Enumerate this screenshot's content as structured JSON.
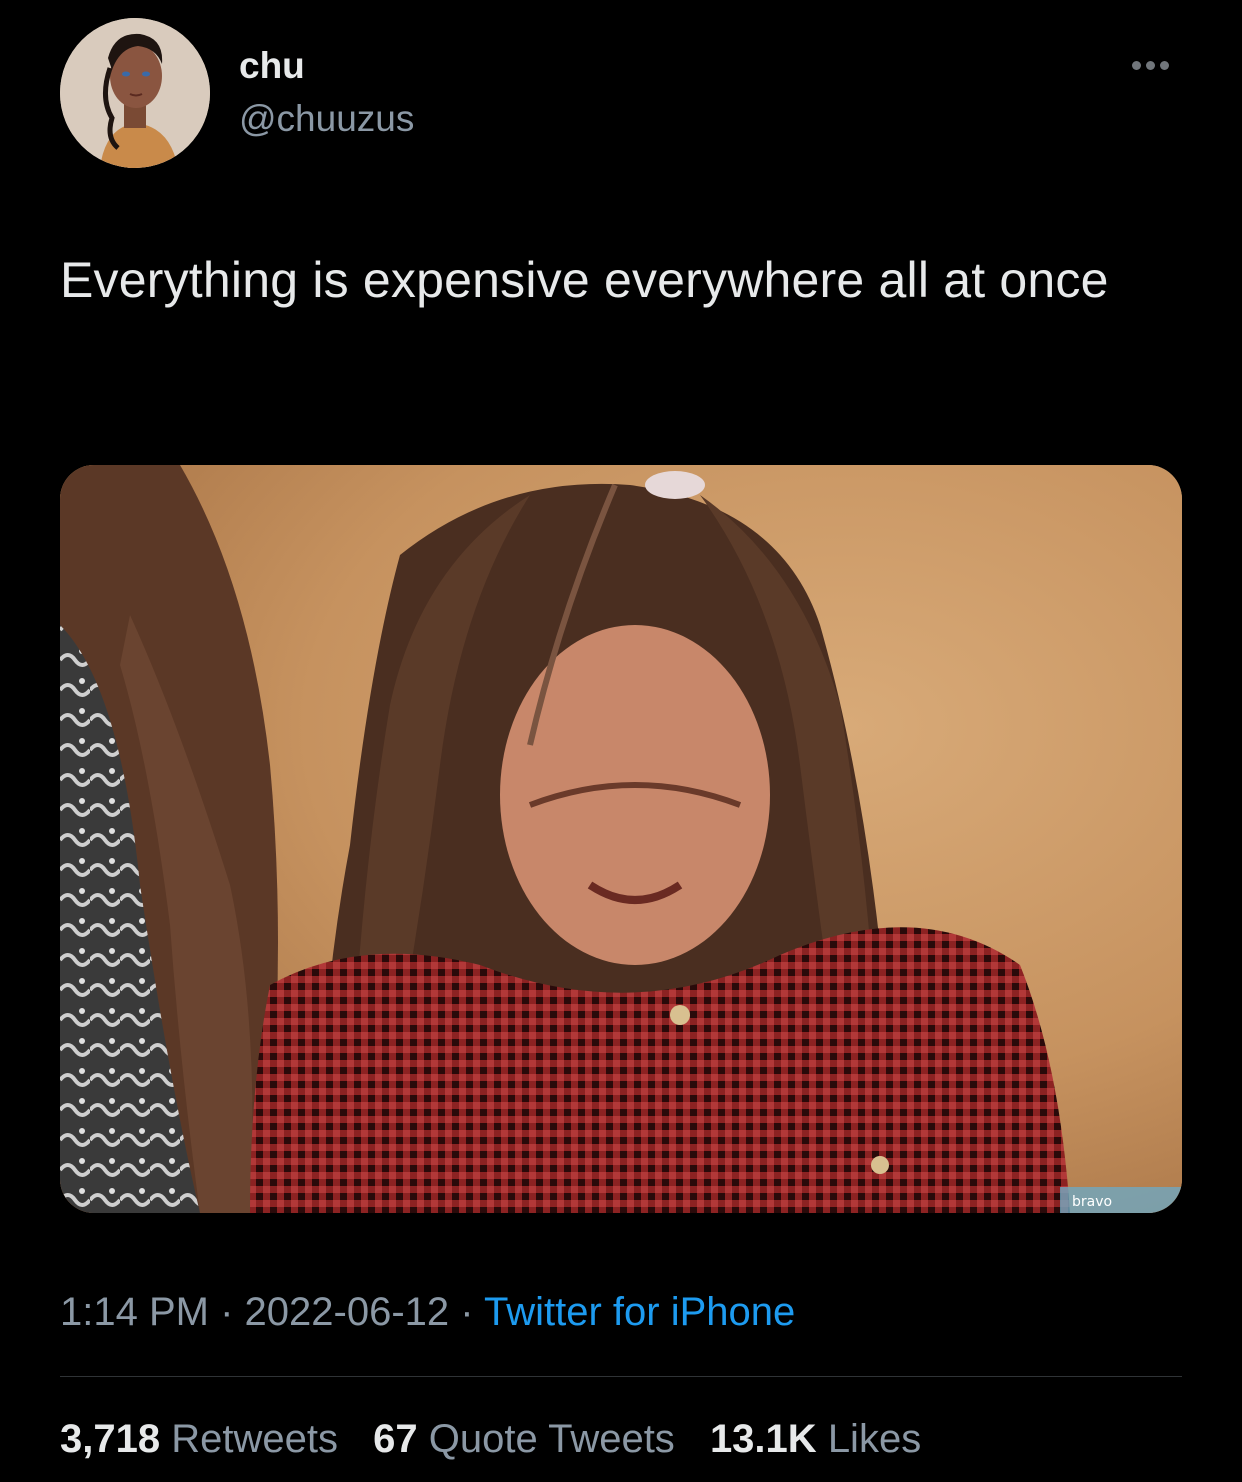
{
  "tweet": {
    "display_name": "chu",
    "handle": "@chuuzus",
    "text": "Everything is expensive everywhere all at once",
    "time": "1:14 PM",
    "separator": "·",
    "date": "2022-06-12",
    "source": "Twitter for iPhone",
    "media_watermark": "bravo"
  },
  "stats": {
    "retweets_count": "3,718",
    "retweets_label": "Retweets",
    "quotes_count": "67",
    "quotes_label": "Quote Tweets",
    "likes_count": "13.1K",
    "likes_label": "Likes"
  },
  "icons": {
    "more": "more-horizontal-icon"
  },
  "colors": {
    "background": "#000000",
    "primary_text": "#e7e9ea",
    "secondary_text": "#8b98a5",
    "link": "#1d9bf0",
    "divider": "#2f3336"
  }
}
